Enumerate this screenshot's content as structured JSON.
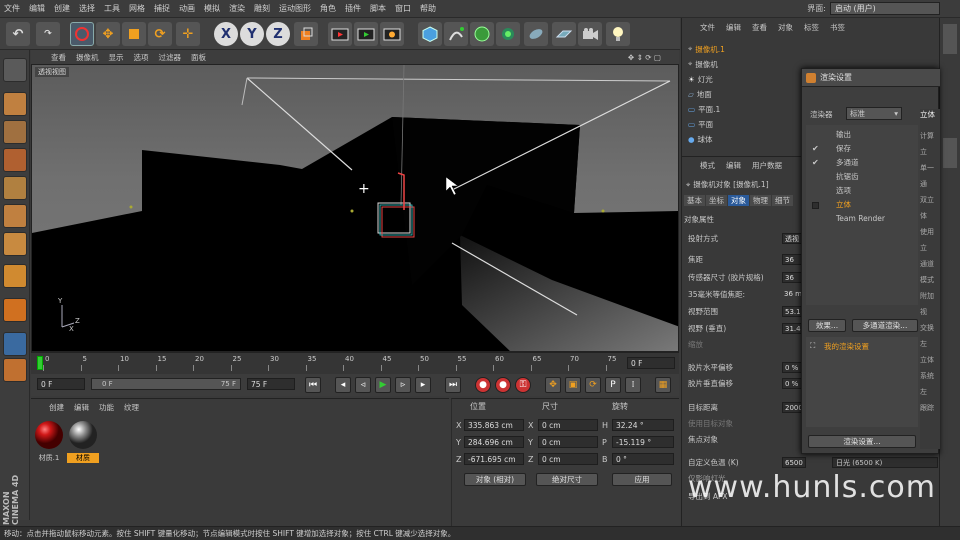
{
  "menubar": {
    "items": [
      "文件",
      "编辑",
      "创建",
      "选择",
      "工具",
      "网格",
      "捕捉",
      "动画",
      "模拟",
      "渲染",
      "雕刻",
      "运动图形",
      "角色",
      "插件",
      "脚本",
      "窗口",
      "帮助"
    ],
    "interface_label": "界面:",
    "interface_value": "启动 (用户)"
  },
  "toolbar": {
    "axis_x": "X",
    "axis_y": "Y",
    "axis_z": "Z"
  },
  "viewport": {
    "menu": [
      "查看",
      "摄像机",
      "显示",
      "选项",
      "过滤器",
      "面板"
    ],
    "label": "透视视图"
  },
  "timeline": {
    "ticks": [
      "0",
      "5",
      "10",
      "15",
      "20",
      "25",
      "30",
      "35",
      "40",
      "45",
      "50",
      "55",
      "60",
      "65",
      "70",
      "75"
    ],
    "end_frame": "0 F"
  },
  "playbar": {
    "current_frame": "0 F",
    "range_start": "0 F",
    "range_end": "75 F",
    "max_frame": "75 F"
  },
  "materials": {
    "menu": [
      "创建",
      "编辑",
      "功能",
      "纹理"
    ],
    "items": [
      {
        "name": "材质.1",
        "color": "#c81818"
      },
      {
        "name": "材质",
        "color": "#9a9a9a"
      }
    ]
  },
  "coords": {
    "headers": [
      "位置",
      "尺寸",
      "旋转"
    ],
    "rows": [
      {
        "axis": "X",
        "pos": "335.863 cm",
        "size_axis": "X",
        "size": "0 cm",
        "rot_axis": "H",
        "rot": "32.24 °"
      },
      {
        "axis": "Y",
        "pos": "284.696 cm",
        "size_axis": "Y",
        "size": "0 cm",
        "rot_axis": "P",
        "rot": "-15.119 °"
      },
      {
        "axis": "Z",
        "pos": "-671.695 cm",
        "size_axis": "Z",
        "size": "0 cm",
        "rot_axis": "B",
        "rot": "0 °"
      }
    ],
    "mode": "对象 (相对)",
    "size_mode": "绝对尺寸",
    "apply": "应用"
  },
  "status": "移动：点击并拖动鼠标移动元素。按住 SHIFT 键量化移动；节点编辑模式时按住 SHIFT 键增加选择对象；按住 CTRL 键减少选择对象。",
  "objects": {
    "menu": [
      "文件",
      "编辑",
      "查看",
      "对象",
      "标签",
      "书签"
    ],
    "items": [
      "摄像机.1",
      "摄像机",
      "灯光",
      "地面",
      "平面.1",
      "平面",
      "球体"
    ]
  },
  "attributes": {
    "menu": [
      "模式",
      "编辑",
      "用户数据"
    ],
    "title": "摄像机对象 [摄像机.1]",
    "tabs": [
      "基本",
      "坐标",
      "对象",
      "物理",
      "细节"
    ],
    "section": "对象属性",
    "rows": [
      {
        "label": "投射方式",
        "value": "透视"
      },
      {
        "label": "焦距",
        "value": "36"
      },
      {
        "label": "传感器尺寸 (胶片规格)",
        "value": "36"
      },
      {
        "label": "35毫米等值焦距:",
        "value": "36 mm"
      },
      {
        "label": "视野范围",
        "value": "53.1"
      },
      {
        "label": "视野 (垂直)",
        "value": "31.4"
      },
      {
        "label": "缩放",
        "value": ""
      },
      {
        "label": "胶片水平偏移",
        "value": "0 %"
      },
      {
        "label": "胶片垂直偏移",
        "value": "0 %"
      },
      {
        "label": "目标距离",
        "value": "2000"
      },
      {
        "label": "使用目标对象",
        "value": ""
      },
      {
        "label": "焦点对象",
        "value": ""
      },
      {
        "label": "自定义色温 (K)",
        "value": "6500"
      },
      {
        "label": "仅影响灯光",
        "value": ""
      },
      {
        "label": "导出到 AFX",
        "value": ""
      }
    ],
    "light_preset": "日光 (6500 K)"
  },
  "render_dialog": {
    "title": "渲染设置",
    "renderer_label": "渲染器",
    "renderer_value": "标准",
    "items": [
      "输出",
      "保存",
      "多通道",
      "抗锯齿",
      "选项",
      "立体",
      "Team Render"
    ],
    "effects_btn": "效果...",
    "multipass_btn": "多通道渲染...",
    "preset": "我的渲染设置",
    "settings_btn": "渲染设置...",
    "right_header": "立体",
    "right_items": [
      "计算立",
      "单一通",
      "双立体",
      "使用立",
      "通道",
      "模式",
      "附加视",
      "交换左",
      "立体",
      "系统",
      "左",
      "跟踪"
    ]
  },
  "watermark": "www.hunls.com",
  "brand": "MAXON CINEMA 4D"
}
